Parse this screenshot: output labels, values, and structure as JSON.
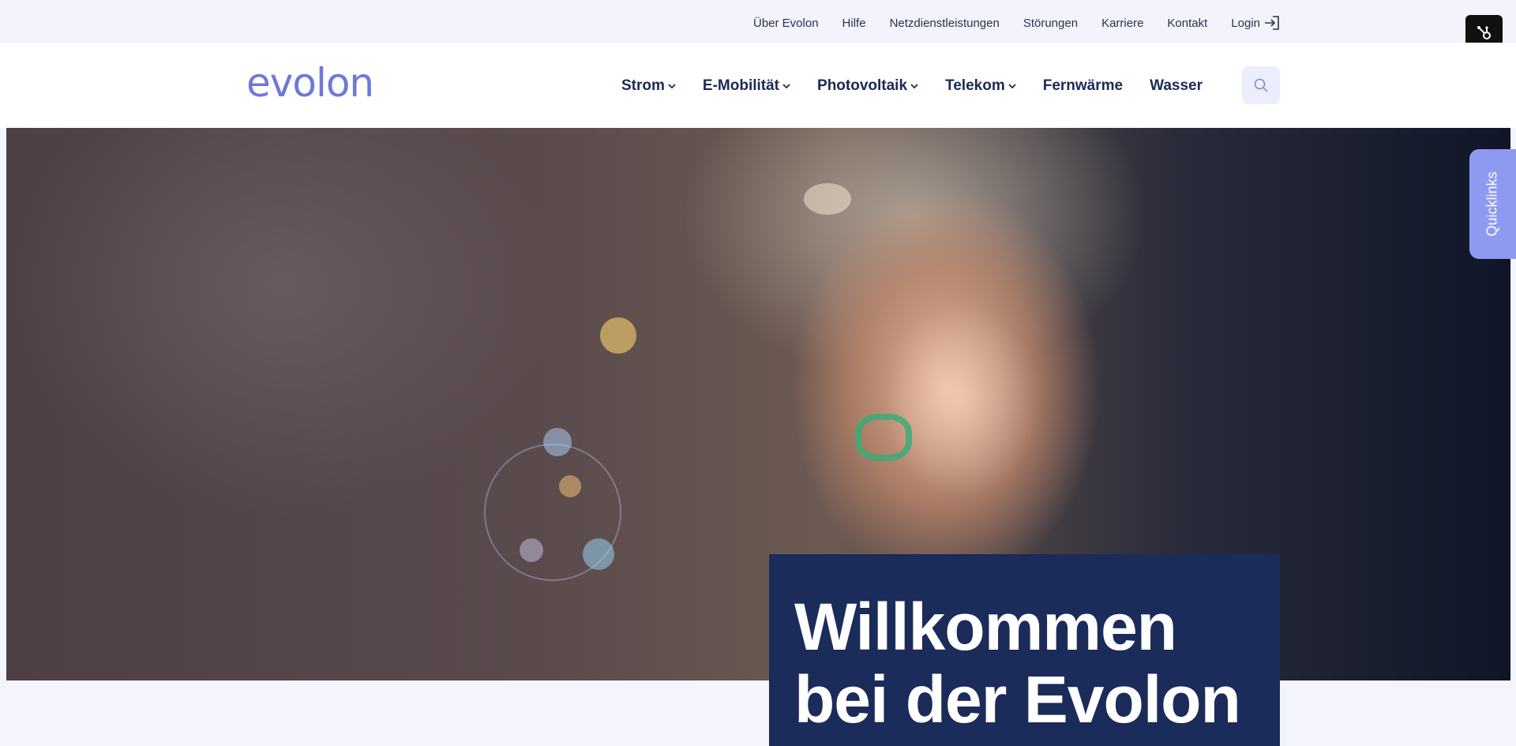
{
  "topbar": {
    "links": [
      "Über Evolon",
      "Hilfe",
      "Netzdienstleistungen",
      "Störungen",
      "Karriere",
      "Kontakt"
    ],
    "login_label": "Login"
  },
  "header": {
    "logo_text": "evolon",
    "nav": [
      {
        "label": "Strom",
        "dropdown": true
      },
      {
        "label": "E-Mobilität",
        "dropdown": true
      },
      {
        "label": "Photovoltaik",
        "dropdown": true
      },
      {
        "label": "Telekom",
        "dropdown": true
      },
      {
        "label": "Fernwärme",
        "dropdown": false
      },
      {
        "label": "Wasser",
        "dropdown": false
      }
    ],
    "search_icon": "search-icon"
  },
  "hero": {
    "title_line1": "Willkommen",
    "title_line2": "bei der Evolon",
    "image_description_icon": "hero-image"
  },
  "quicklinks_label": "Quicklinks",
  "colors": {
    "brand": "#6f78d8",
    "navy": "#1b2b5a",
    "quicklinks": "#8e9af0"
  }
}
